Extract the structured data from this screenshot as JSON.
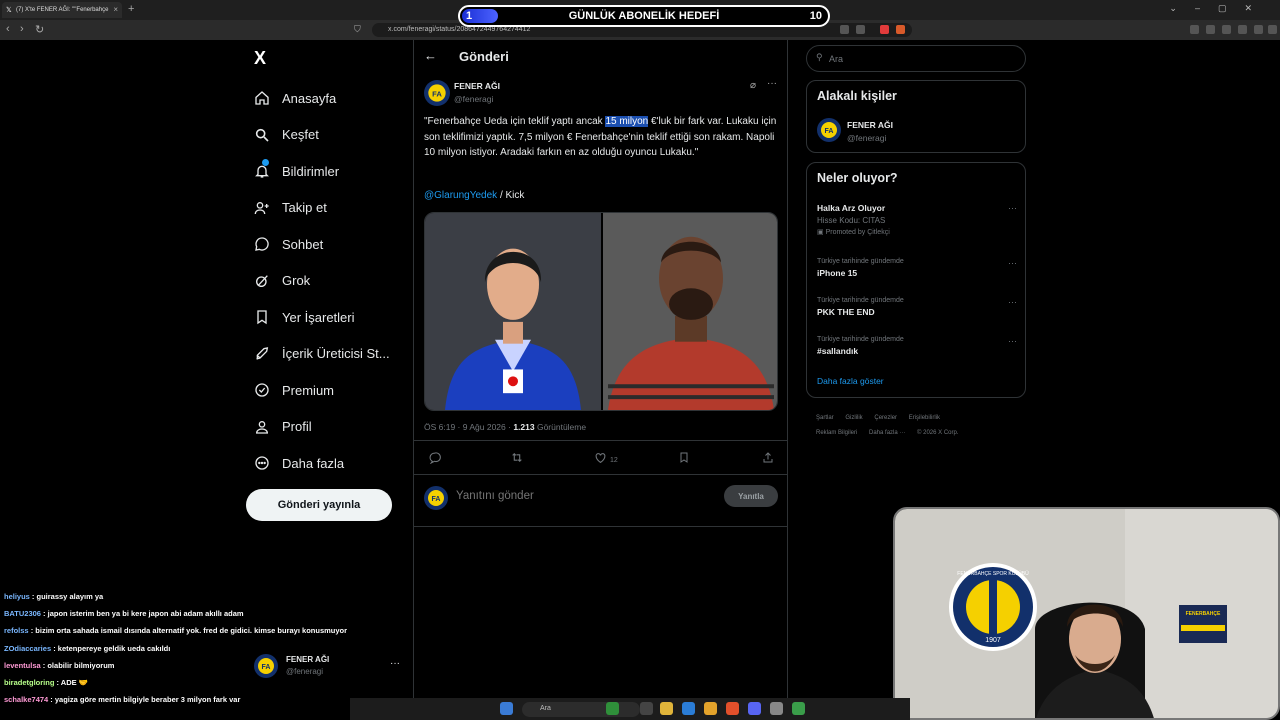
{
  "browser": {
    "tab_title": "(7) X'te FENER AĞI: \"\"Fenerbahçe",
    "url": "x.com/feneragi/status/2086472449764274412"
  },
  "overlay": {
    "goal_title": "GÜNLÜK ABONELİK HEDEFİ",
    "goal_current": "1",
    "goal_target": "10",
    "goal_progress": 0.1
  },
  "sidebar": {
    "logo": "X",
    "items": [
      {
        "label": "Anasayfa",
        "icon": "home-icon"
      },
      {
        "label": "Keşfet",
        "icon": "search-icon"
      },
      {
        "label": "Bildirimler",
        "icon": "bell-icon"
      },
      {
        "label": "Takip et",
        "icon": "add-person-icon"
      },
      {
        "label": "Sohbet",
        "icon": "chat-icon"
      },
      {
        "label": "Grok",
        "icon": "grok-icon"
      },
      {
        "label": "Yer İşaretleri",
        "icon": "bookmark-icon"
      },
      {
        "label": "İçerik Üreticisi St...",
        "icon": "rocket-icon"
      },
      {
        "label": "Premium",
        "icon": "verified-icon"
      },
      {
        "label": "Profil",
        "icon": "person-icon"
      },
      {
        "label": "Daha fazla",
        "icon": "more-circle-icon"
      }
    ],
    "post_button": "Gönderi yayınla",
    "account": {
      "name": "FENER AĞI",
      "handle": "@feneragi"
    }
  },
  "main": {
    "header_title": "Gönderi",
    "tweet": {
      "author": "FENER AĞI",
      "handle": "@feneragi",
      "text_before": "\"Fenerbahçe Ueda için teklif yaptı ancak ",
      "text_highlight": "15 milyon",
      "text_after": " €'luk bir fark var. Lukaku için son teklifimizi yaptık. 7,5 milyon € Fenerbahçe'nin teklif ettiği son rakam. Napoli 10 milyon istiyor. Aradaki farkın en az olduğu oyuncu Lukaku.\"",
      "mention": "@GlarungYedek",
      "mention_suffix": " / Kick",
      "time": "ÖS 6:19 · 9 Ağu 2026 · ",
      "views": "1.213",
      "views_label": " Görüntüleme",
      "likes": "12"
    },
    "reply_placeholder": "Yanıtını gönder",
    "reply_button": "Yanıtla"
  },
  "right": {
    "search_placeholder": "Ara",
    "related_title": "Alakalı kişiler",
    "related": {
      "name": "FENER AĞI",
      "handle": "@feneragi"
    },
    "trends_title": "Neler oluyor?",
    "trends": [
      {
        "caption": "",
        "title": "Halka Arz Oluyor",
        "sub": "Hisse Kodu: CITAS",
        "promo": "Promoted by Çitlekçi"
      },
      {
        "caption": "Türkiye tarihinde gündemde",
        "title": "iPhone 15"
      },
      {
        "caption": "Türkiye tarihinde gündemde",
        "title": "PKK THE END"
      },
      {
        "caption": "Türkiye tarihinde gündemde",
        "title": "#sallandık"
      }
    ],
    "show_more": "Daha fazla göster",
    "footer": [
      "Şartlar",
      "Gizlilik",
      "Çerezler",
      "Erişilebilirlik",
      "Reklam Bilgileri",
      "Daha fazla ···",
      "© 2026 X Corp."
    ]
  },
  "chat": [
    {
      "user": "heliyus",
      "msg": " : guirassy alayım ya"
    },
    {
      "user": "BATU2306",
      "msg": " : japon isterim ben ya bi kere japon abi adam akıllı adam"
    },
    {
      "user": "refolss",
      "msg": " : bizim orta sahada ismail dısında alternatif yok. fred de gidici. kimse burayı konusmuyor"
    },
    {
      "user": "ZOdiaccaries",
      "msg": " : ketenpereye geldik ueda cakıldı"
    },
    {
      "user": "leventulsa",
      "msg": " : olabilir bilmiyorum"
    },
    {
      "user": "biradetgloring",
      "msg": " :  ADE 🤝"
    },
    {
      "user": "schalke7474",
      "msg": " : yagiza göre mertin bilgiyle beraber 3 milyon fark var"
    }
  ],
  "taskbar": {
    "search": "Ara"
  },
  "webcam": {
    "club_text": "FENERBAHÇE SPOR KULÜBÜ",
    "year": "1907",
    "sign": "FENERBAHÇE"
  }
}
